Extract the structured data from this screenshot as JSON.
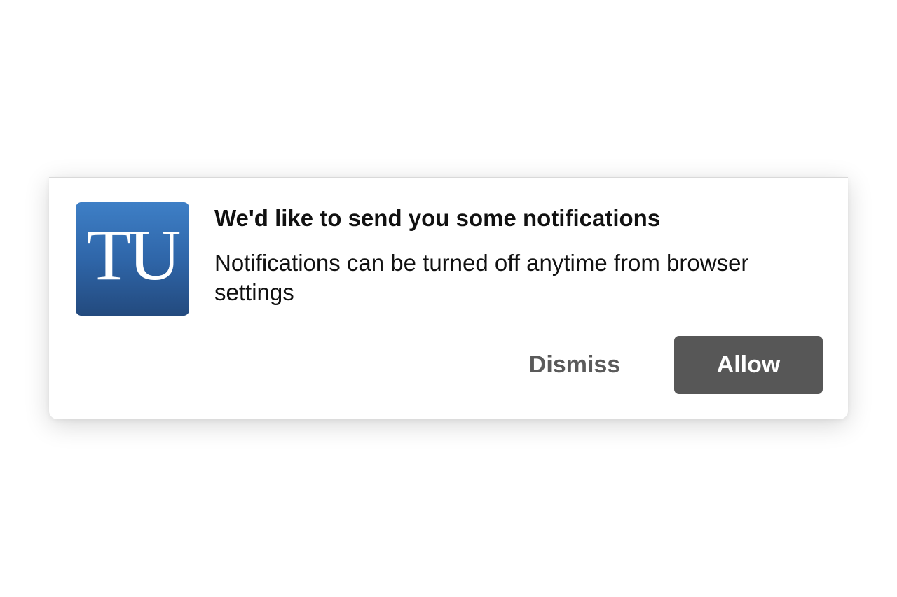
{
  "notification_prompt": {
    "logo": {
      "text": "TU",
      "colors": {
        "top": "#3e7fc6",
        "bottom": "#234a7e"
      }
    },
    "title": "We'd like to send you some notifications",
    "message": "Notifications can be turned off anytime from browser settings",
    "dismiss_label": "Dismiss",
    "allow_label": "Allow",
    "colors": {
      "allow_background": "#575757",
      "dismiss_text": "#5a5a5a"
    }
  }
}
